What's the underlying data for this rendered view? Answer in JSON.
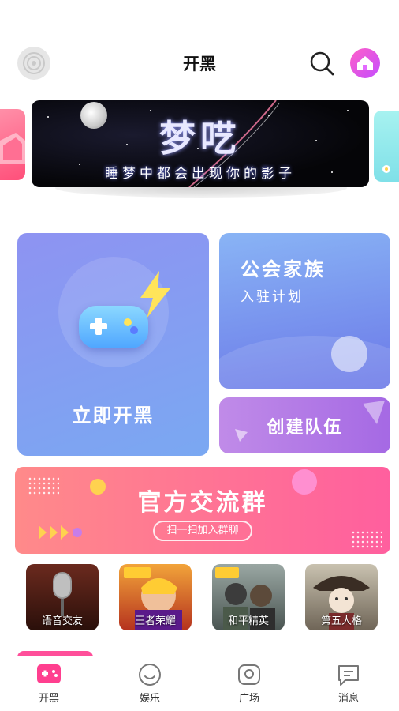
{
  "header": {
    "title": "开黑",
    "left_icon": "radar-icon",
    "search_icon": "search-icon",
    "home_icon": "home-icon",
    "accent": "#d94dff"
  },
  "banner": {
    "title": "梦呓",
    "subtitle": "睡梦中都会出现你的影子"
  },
  "cards": {
    "main": {
      "label": "立即开黑",
      "icon": "gamepad-icon",
      "color": "#8a99f2"
    },
    "guild": {
      "title": "公会家族",
      "subtitle": "入驻计划",
      "color": "#7c95ee"
    },
    "team": {
      "label": "创建队伍",
      "color": "#b47ae6"
    }
  },
  "group_banner": {
    "title": "官方交流群",
    "button": "扫一扫加入群聊",
    "color": "#ff6f96"
  },
  "games": [
    {
      "label": "语音交友",
      "icon": "microphone-icon"
    },
    {
      "label": "王者荣耀",
      "icon": "hero-icon"
    },
    {
      "label": "和平精英",
      "icon": "soldier-icon"
    },
    {
      "label": "第五人格",
      "icon": "doll-icon"
    }
  ],
  "nav": [
    {
      "label": "开黑",
      "icon": "gamepad-icon",
      "active": true,
      "color": "#ff3f8f"
    },
    {
      "label": "娱乐",
      "icon": "smile-icon",
      "active": false
    },
    {
      "label": "广场",
      "icon": "plaza-icon",
      "active": false
    },
    {
      "label": "消息",
      "icon": "message-icon",
      "active": false
    }
  ]
}
